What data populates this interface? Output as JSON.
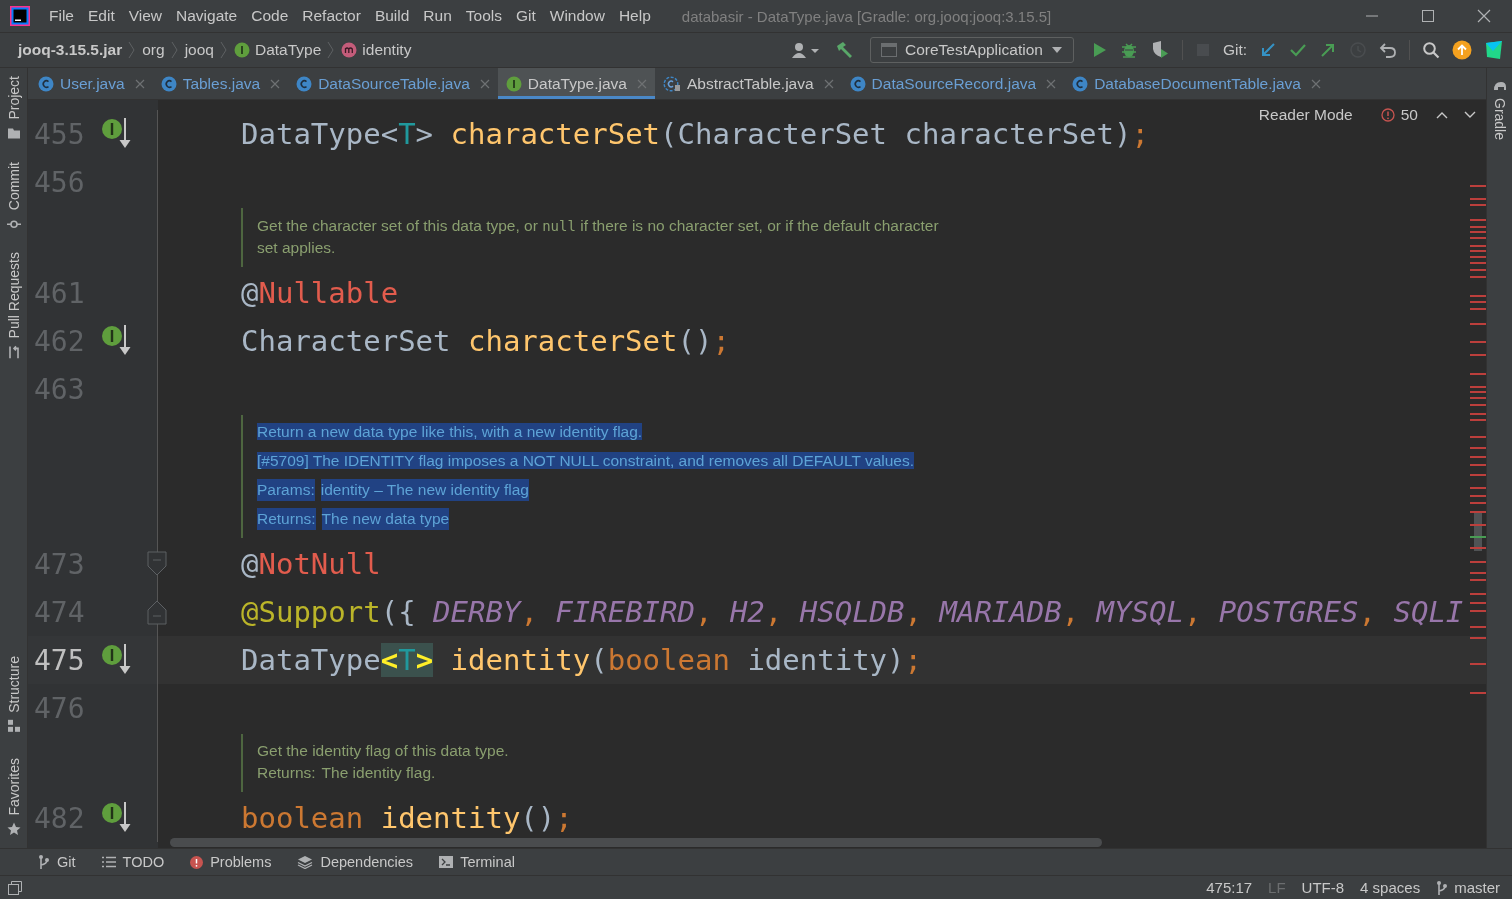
{
  "menu_bar": {
    "items": [
      {
        "label": "File"
      },
      {
        "label": "Edit"
      },
      {
        "label": "View"
      },
      {
        "label": "Navigate"
      },
      {
        "label": "Code"
      },
      {
        "label": "Refactor"
      },
      {
        "label": "Build"
      },
      {
        "label": "Run"
      },
      {
        "label": "Tools"
      },
      {
        "label": "Git"
      },
      {
        "label": "Window"
      },
      {
        "label": "Help"
      }
    ],
    "title": "databasir - DataType.java [Gradle: org.jooq:jooq:3.15.5]"
  },
  "nav_bar": {
    "breadcrumbs": [
      {
        "label": "jooq-3.15.5.jar",
        "kind": "jar"
      },
      {
        "label": "org",
        "kind": "package"
      },
      {
        "label": "jooq",
        "kind": "package"
      },
      {
        "label": "DataType",
        "kind": "interface"
      },
      {
        "label": "identity",
        "kind": "method"
      }
    ],
    "toolbar": [
      {
        "kind": "user",
        "disabled": false
      },
      {
        "kind": "build",
        "disabled": false
      },
      {
        "kind": "run_config",
        "label": "CoreTestApplication",
        "disabled": false
      },
      {
        "kind": "run",
        "disabled": false
      },
      {
        "kind": "debug",
        "disabled": false
      },
      {
        "kind": "coverage",
        "disabled": false
      },
      {
        "kind": "stop",
        "disabled": true
      },
      {
        "kind": "label",
        "label": "Git:",
        "disabled": false
      },
      {
        "kind": "update",
        "disabled": false
      },
      {
        "kind": "commit",
        "disabled": false
      },
      {
        "kind": "push",
        "disabled": false
      },
      {
        "kind": "history",
        "disabled": true
      },
      {
        "kind": "rollback",
        "disabled": false
      },
      {
        "kind": "search",
        "disabled": false
      },
      {
        "kind": "ide_update",
        "disabled": false
      },
      {
        "kind": "toolbox",
        "disabled": false
      }
    ]
  },
  "tabs": [
    {
      "label": "User.java",
      "kind": "class",
      "color": "#6a9fd4",
      "selected": false
    },
    {
      "label": "Tables.java",
      "kind": "class",
      "color": "#6a9fd4",
      "selected": false
    },
    {
      "label": "DataSourceTable.java",
      "kind": "class",
      "color": "#6a9fd4",
      "selected": false
    },
    {
      "label": "DataType.java",
      "kind": "interface",
      "color": "#c8c8c8",
      "selected": true
    },
    {
      "label": "AbstractTable.java",
      "kind": "abstract",
      "color": "#c8c8c8",
      "selected": false
    },
    {
      "label": "DataSourceRecord.java",
      "kind": "class",
      "color": "#6a9fd4",
      "selected": false
    },
    {
      "label": "DatabaseDocumentTable.java",
      "kind": "class",
      "color": "#6a9fd4",
      "selected": false
    }
  ],
  "left_tool_windows": {
    "top": [
      {
        "label": "Project",
        "kind": "project"
      },
      {
        "label": "Commit",
        "kind": "commit"
      },
      {
        "label": "Pull Requests",
        "kind": "pull_requests"
      }
    ],
    "bottom": [
      {
        "label": "Structure",
        "kind": "structure"
      },
      {
        "label": "Favorites",
        "kind": "favorites"
      }
    ]
  },
  "right_tool_windows": [
    {
      "label": "Gradle",
      "kind": "gradle"
    }
  ],
  "editor": {
    "reader_mode": "Reader Mode",
    "problems_count": "50",
    "rows": [
      {
        "kind": "code",
        "line": "455",
        "gutter_icon": {
          "kind": "implemented"
        },
        "current": false,
        "tokens": [
          {
            "t": "DataType<",
            "kind": "plain"
          },
          {
            "t": "T",
            "kind": "tparam"
          },
          {
            "t": ">",
            "kind": "plain"
          },
          {
            "t": " characterSet",
            "kind": "method"
          },
          {
            "t": "(CharacterSet characterSet)",
            "kind": "plain"
          },
          {
            "t": ";",
            "kind": "keyword"
          }
        ]
      },
      {
        "kind": "code",
        "line": "456",
        "current": false,
        "tokens": []
      },
      {
        "kind": "doc",
        "selected": false,
        "paragraphs": [
          {
            "kind": "text",
            "parts": [
              {
                "text": "Get the character set of this data type, or ",
                "kind": "text"
              },
              {
                "text": "null",
                "kind": "code"
              },
              {
                "text": " if there is no character set, or if the default character set applies.",
                "kind": "text"
              }
            ]
          }
        ]
      },
      {
        "kind": "code",
        "line": "461",
        "current": false,
        "tokens": [
          {
            "t": "@",
            "kind": "plain"
          },
          {
            "t": "Nullable",
            "kind": "annotation_marked"
          }
        ]
      },
      {
        "kind": "code",
        "line": "462",
        "gutter_icon": {
          "kind": "implemented"
        },
        "current": false,
        "tokens": [
          {
            "t": "CharacterSet",
            "kind": "plain"
          },
          {
            "t": " characterSet",
            "kind": "method"
          },
          {
            "t": "()",
            "kind": "plain"
          },
          {
            "t": ";",
            "kind": "keyword"
          }
        ]
      },
      {
        "kind": "code",
        "line": "463",
        "current": false,
        "tokens": []
      },
      {
        "kind": "doc",
        "selected": true,
        "paragraphs": [
          {
            "kind": "text",
            "parts": [
              {
                "text": "Return a new data type like this, with a new identity flag.",
                "kind": "text"
              }
            ]
          },
          {
            "kind": "text",
            "parts": [
              {
                "text": "[#5709] The IDENTITY flag imposes a NOT NULL constraint, and removes all DEFAULT values.",
                "kind": "text"
              }
            ]
          },
          {
            "kind": "tag",
            "label": "Params:",
            "text": "identity – The new identity flag"
          },
          {
            "kind": "tag",
            "label": "Returns:",
            "text": "The new data type"
          }
        ]
      },
      {
        "kind": "code",
        "line": "473",
        "gutter_icon": {
          "kind": "fold_start"
        },
        "current": false,
        "tokens": [
          {
            "t": "@",
            "kind": "plain"
          },
          {
            "t": "NotNull",
            "kind": "annotation_marked"
          }
        ]
      },
      {
        "kind": "code",
        "line": "474",
        "gutter_icon": {
          "kind": "fold_end"
        },
        "current": false,
        "tokens": [
          {
            "t": "@Support",
            "kind": "annotation"
          },
          {
            "t": "({",
            "kind": "plain"
          },
          {
            "t": " DERBY",
            "kind": "constant"
          },
          {
            "t": ",",
            "kind": "keyword"
          },
          {
            "t": " FIREBIRD",
            "kind": "constant"
          },
          {
            "t": ",",
            "kind": "keyword"
          },
          {
            "t": " H2",
            "kind": "constant"
          },
          {
            "t": ",",
            "kind": "keyword"
          },
          {
            "t": " HSQLDB",
            "kind": "constant"
          },
          {
            "t": ",",
            "kind": "keyword"
          },
          {
            "t": " MARIADB",
            "kind": "constant"
          },
          {
            "t": ",",
            "kind": "keyword"
          },
          {
            "t": " MYSQL",
            "kind": "constant"
          },
          {
            "t": ",",
            "kind": "keyword"
          },
          {
            "t": " POSTGRES",
            "kind": "constant"
          },
          {
            "t": ",",
            "kind": "keyword"
          },
          {
            "t": " SQLI",
            "kind": "constant"
          }
        ]
      },
      {
        "kind": "code",
        "line": "475",
        "gutter_icon": {
          "kind": "implemented"
        },
        "current": true,
        "tokens": [
          {
            "t": "DataType",
            "kind": "plain"
          },
          {
            "t": "<",
            "kind": "brace_match"
          },
          {
            "t": "T",
            "kind": "tparam_in_match"
          },
          {
            "t": ">",
            "kind": "brace_match"
          },
          {
            "t": " identity",
            "kind": "method"
          },
          {
            "t": "(",
            "kind": "plain"
          },
          {
            "t": "boolean",
            "kind": "keyword"
          },
          {
            "t": " identity)",
            "kind": "plain"
          },
          {
            "t": ";",
            "kind": "keyword"
          }
        ]
      },
      {
        "kind": "code",
        "line": "476",
        "current": false,
        "tokens": []
      },
      {
        "kind": "doc",
        "selected": false,
        "paragraphs": [
          {
            "kind": "text",
            "parts": [
              {
                "text": "Get the identity flag of this data type.",
                "kind": "text"
              }
            ]
          },
          {
            "kind": "tag",
            "label": "Returns:",
            "text": "The identity flag."
          }
        ]
      },
      {
        "kind": "code",
        "line": "482",
        "gutter_icon": {
          "kind": "implemented"
        },
        "current": false,
        "tokens": [
          {
            "t": "boolean",
            "kind": "keyword"
          },
          {
            "t": " identity",
            "kind": "method"
          },
          {
            "t": "()",
            "kind": "plain"
          },
          {
            "t": ";",
            "kind": "keyword"
          }
        ]
      }
    ]
  },
  "tool_bar": [
    {
      "label": "Git",
      "kind": "git"
    },
    {
      "label": "TODO",
      "kind": "todo"
    },
    {
      "label": "Problems",
      "kind": "problems"
    },
    {
      "label": "Dependencies",
      "kind": "dependencies"
    },
    {
      "label": "Terminal",
      "kind": "terminal"
    }
  ],
  "status_bar": [
    {
      "label": "475:17",
      "kind": "text",
      "disabled": false
    },
    {
      "label": "LF",
      "kind": "text",
      "disabled": true
    },
    {
      "label": "UTF-8",
      "kind": "text",
      "disabled": false
    },
    {
      "label": "4 spaces",
      "kind": "text",
      "disabled": false
    },
    {
      "label": "master",
      "kind": "branch",
      "disabled": false
    }
  ]
}
